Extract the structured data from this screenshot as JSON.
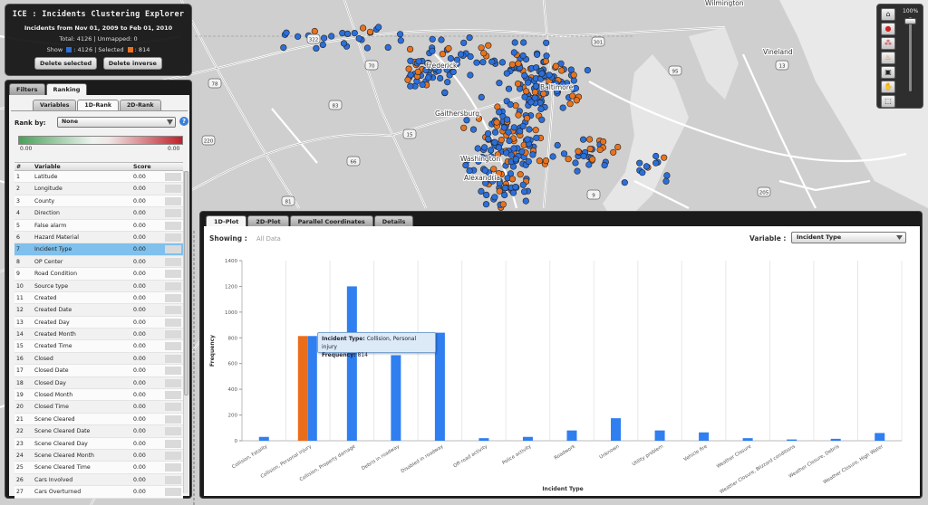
{
  "title_box": {
    "title": "ICE : Incidents Clustering Explorer",
    "range_prefix": "Incidents from",
    "range_from": "Nov 01, 2009",
    "range_mid": "to",
    "range_to": "Feb 01, 2010",
    "totals": "Total: 4126 | Unmapped: 0",
    "show_label": "Show",
    "show_count": ": 4126 | Selected",
    "selected_count": ": 814",
    "show_color": "#2b6fdb",
    "selected_color": "#e8731f",
    "delete_selected": "Delete selected",
    "delete_inverse": "Delete inverse"
  },
  "left_panel": {
    "tabs": [
      "Filters",
      "Ranking"
    ],
    "active_tab": "Ranking",
    "sub_tabs": [
      "Variables",
      "1D-Rank",
      "2D-Rank"
    ],
    "active_sub_tab": "1D-Rank",
    "rank_by_label": "Rank by:",
    "rank_by_value": "None",
    "help_glyph": "?",
    "gradient_min": "0.00",
    "gradient_max": "0.00",
    "table_headers": {
      "num": "#",
      "variable": "Variable",
      "score": "Score"
    },
    "rows": [
      {
        "n": "1",
        "name": "Latitude",
        "score": "0.00"
      },
      {
        "n": "2",
        "name": "Longitude",
        "score": "0.00"
      },
      {
        "n": "3",
        "name": "County",
        "score": "0.00"
      },
      {
        "n": "4",
        "name": "Direction",
        "score": "0.00"
      },
      {
        "n": "5",
        "name": "False alarm",
        "score": "0.00"
      },
      {
        "n": "6",
        "name": "Hazard Material",
        "score": "0.00"
      },
      {
        "n": "7",
        "name": "Incident Type",
        "score": "0.00"
      },
      {
        "n": "8",
        "name": "OP Center",
        "score": "0.00"
      },
      {
        "n": "9",
        "name": "Road Condition",
        "score": "0.00"
      },
      {
        "n": "10",
        "name": "Source type",
        "score": "0.00"
      },
      {
        "n": "11",
        "name": "Created",
        "score": "0.00"
      },
      {
        "n": "12",
        "name": "Created Date",
        "score": "0.00"
      },
      {
        "n": "13",
        "name": "Created Day",
        "score": "0.00"
      },
      {
        "n": "14",
        "name": "Created Month",
        "score": "0.00"
      },
      {
        "n": "15",
        "name": "Created Time",
        "score": "0.00"
      },
      {
        "n": "16",
        "name": "Closed",
        "score": "0.00"
      },
      {
        "n": "17",
        "name": "Closed Date",
        "score": "0.00"
      },
      {
        "n": "18",
        "name": "Closed Day",
        "score": "0.00"
      },
      {
        "n": "19",
        "name": "Closed Month",
        "score": "0.00"
      },
      {
        "n": "20",
        "name": "Closed Time",
        "score": "0.00"
      },
      {
        "n": "21",
        "name": "Scene Cleared",
        "score": "0.00"
      },
      {
        "n": "22",
        "name": "Scene Cleared Date",
        "score": "0.00"
      },
      {
        "n": "23",
        "name": "Scene Cleared Day",
        "score": "0.00"
      },
      {
        "n": "24",
        "name": "Scene Cleared Month",
        "score": "0.00"
      },
      {
        "n": "25",
        "name": "Scene Cleared Time",
        "score": "0.00"
      },
      {
        "n": "26",
        "name": "Cars Involved",
        "score": "0.00"
      },
      {
        "n": "27",
        "name": "Cars Overturned",
        "score": "0.00"
      }
    ],
    "selected_row": "Incident Type"
  },
  "map": {
    "labels": [
      "Frederick",
      "Baltimore",
      "Gaithersburg",
      "Washington",
      "Alexandria",
      "Wilmington",
      "Vineland"
    ],
    "route_shields": [
      "322",
      "78",
      "83",
      "220",
      "15",
      "66",
      "81",
      "301",
      "95",
      "9",
      "205",
      "13",
      "70"
    ]
  },
  "toolbar": {
    "zoom_label": "100%",
    "zoom_level_percent": 100,
    "tools": [
      "home-icon",
      "cluster-icon",
      "group-icon",
      "fire-icon",
      "layer-icon",
      "pan-hand-icon",
      "select-box-icon"
    ]
  },
  "chart_panel": {
    "tabs": [
      "1D-Plot",
      "2D-Plot",
      "Parallel Coordinates",
      "Details"
    ],
    "active_tab": "1D-Plot",
    "showing_label": "Showing :",
    "showing_value": "All Data",
    "variable_label": "Variable :",
    "variable_value": "Incident Type",
    "tooltip": {
      "type_label": "Incident Type:",
      "type_value": "Collision, Personal injury",
      "freq_label": "Frequency:",
      "freq_value": "814"
    }
  },
  "chart_data": {
    "type": "bar",
    "xlabel": "Incident Type",
    "ylabel": "Frequency",
    "ylim": [
      0,
      1400
    ],
    "yticks": [
      0,
      200,
      400,
      600,
      800,
      1000,
      1200,
      1400
    ],
    "categories": [
      "Collision, Fatality",
      "Collision, Personal injury",
      "Collision, Property damage",
      "Debris in roadway",
      "Disabled in roadway",
      "Off-road activity",
      "Police activity",
      "Roadwork",
      "Unknown",
      "Utility problem",
      "Vehicle fire",
      "Weather Closure",
      "Weather Closure, Blizzard conditions",
      "Weather Closure, Debris",
      "Weather Closure, High Water"
    ],
    "series": [
      {
        "values": [
          30,
          814,
          1200,
          665,
          840,
          20,
          30,
          80,
          175,
          80,
          65,
          20,
          10,
          15,
          60
        ],
        "color": "#2f7ff0"
      },
      {
        "values": [
          0,
          814,
          0,
          0,
          0,
          0,
          0,
          0,
          0,
          0,
          0,
          0,
          0,
          0,
          0
        ],
        "color": "#ea6d1a"
      }
    ],
    "grid": true,
    "grid_axis": "x"
  }
}
